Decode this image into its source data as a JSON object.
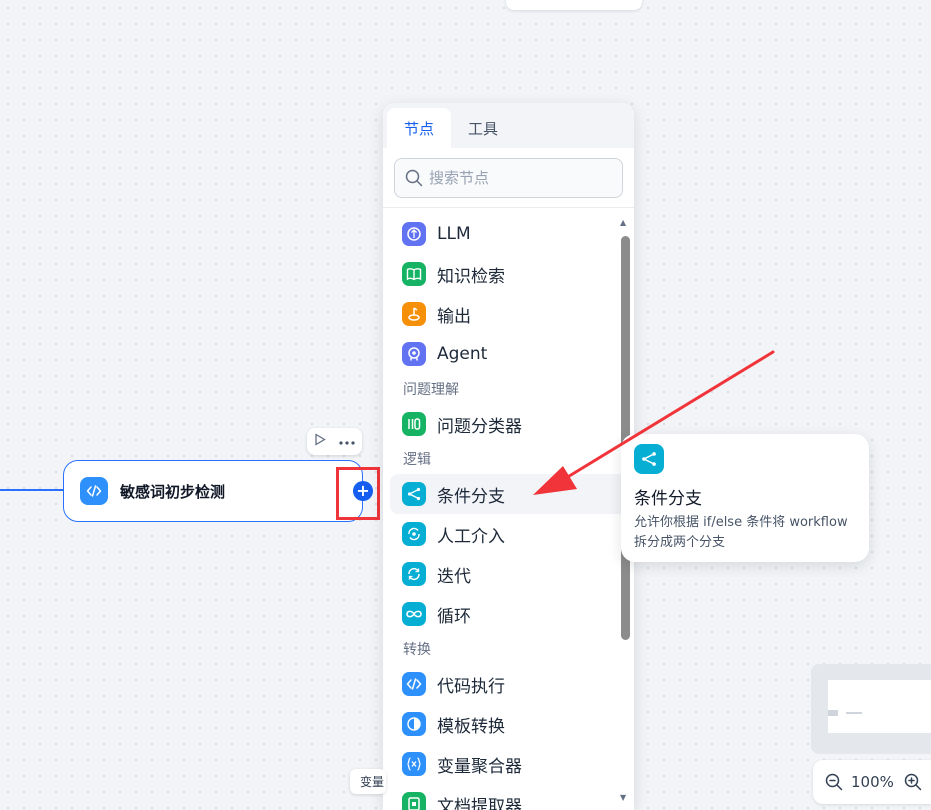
{
  "canvas": {
    "workflow_node": {
      "title": "敏感词初步检测",
      "icon": "code-icon",
      "color": "#2e90fa"
    },
    "toolbar": {
      "run_icon": "play-icon",
      "more_icon": "more-icon"
    },
    "add_button": "+",
    "variable_chip": "变量",
    "zoom": {
      "value": "100%"
    }
  },
  "picker": {
    "tabs": [
      {
        "label": "节点",
        "active": true
      },
      {
        "label": "工具",
        "active": false
      }
    ],
    "search": {
      "placeholder": "搜索节点"
    },
    "groups": [
      {
        "label": "",
        "items": [
          {
            "label": "LLM",
            "icon": "llm-icon",
            "color": "#6172f3"
          },
          {
            "label": "知识检索",
            "icon": "book-icon",
            "color": "#16b364"
          },
          {
            "label": "输出",
            "icon": "output-icon",
            "color": "#f79009"
          },
          {
            "label": "Agent",
            "icon": "agent-icon",
            "color": "#6172f3"
          }
        ]
      },
      {
        "label": "问题理解",
        "items": [
          {
            "label": "问题分类器",
            "icon": "classifier-icon",
            "color": "#16b364"
          }
        ]
      },
      {
        "label": "逻辑",
        "items": [
          {
            "label": "条件分支",
            "icon": "branch-icon",
            "color": "#06aed4",
            "hovered": true
          },
          {
            "label": "人工介入",
            "icon": "human-icon",
            "color": "#06aed4"
          },
          {
            "label": "迭代",
            "icon": "iteration-icon",
            "color": "#06aed4"
          },
          {
            "label": "循环",
            "icon": "loop-icon",
            "color": "#06aed4"
          }
        ]
      },
      {
        "label": "转换",
        "items": [
          {
            "label": "代码执行",
            "icon": "code-icon",
            "color": "#2e90fa"
          },
          {
            "label": "模板转换",
            "icon": "template-icon",
            "color": "#2e90fa"
          },
          {
            "label": "变量聚合器",
            "icon": "variable-icon",
            "color": "#2e90fa"
          },
          {
            "label": "文档提取器",
            "icon": "doc-icon",
            "color": "#16b364"
          }
        ]
      }
    ]
  },
  "tooltip": {
    "title": "条件分支",
    "description": "允许你根据 if/else 条件将 workflow 拆分成两个分支",
    "icon": "branch-icon",
    "color": "#06aed4"
  },
  "annotation": {
    "highlight_color": "#f0343a"
  }
}
